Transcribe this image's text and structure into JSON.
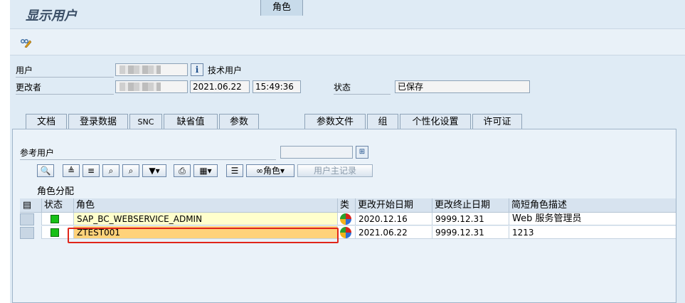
{
  "title": "显示用户",
  "user": {
    "label_user": "用户",
    "label_changed_by": "更改者",
    "tech_user_label": "技术用户",
    "changed_date": "2021.06.22",
    "changed_time": "15:49:36",
    "status_label": "状态",
    "status_value": "已保存"
  },
  "tabs": [
    "文档",
    "登录数据",
    "SNC",
    "缺省值",
    "参数",
    "角色",
    "参数文件",
    "组",
    "个性化设置",
    "许可证"
  ],
  "active_tab": "角色",
  "ref_user_label": "参考用户",
  "toolbar": {
    "role_btn": "角色",
    "user_master_btn": "用户主记录"
  },
  "role_assign_label": "角色分配",
  "grid": {
    "headers": [
      "状态",
      "角色",
      "类",
      "更改开始日期",
      "更改终止日期",
      "简短角色描述"
    ],
    "rows": [
      {
        "role": "SAP_BC_WEBSERVICE_ADMIN",
        "start": "2020.12.16",
        "end": "9999.12.31",
        "desc": "Web 服务管理员"
      },
      {
        "role": "ZTEST001",
        "start": "2021.06.22",
        "end": "9999.12.31",
        "desc": "1213"
      }
    ]
  },
  "colors": {
    "status_ok": "#17c017",
    "highlight_row": "#ffd27a",
    "selected_box": "#e0261a"
  }
}
